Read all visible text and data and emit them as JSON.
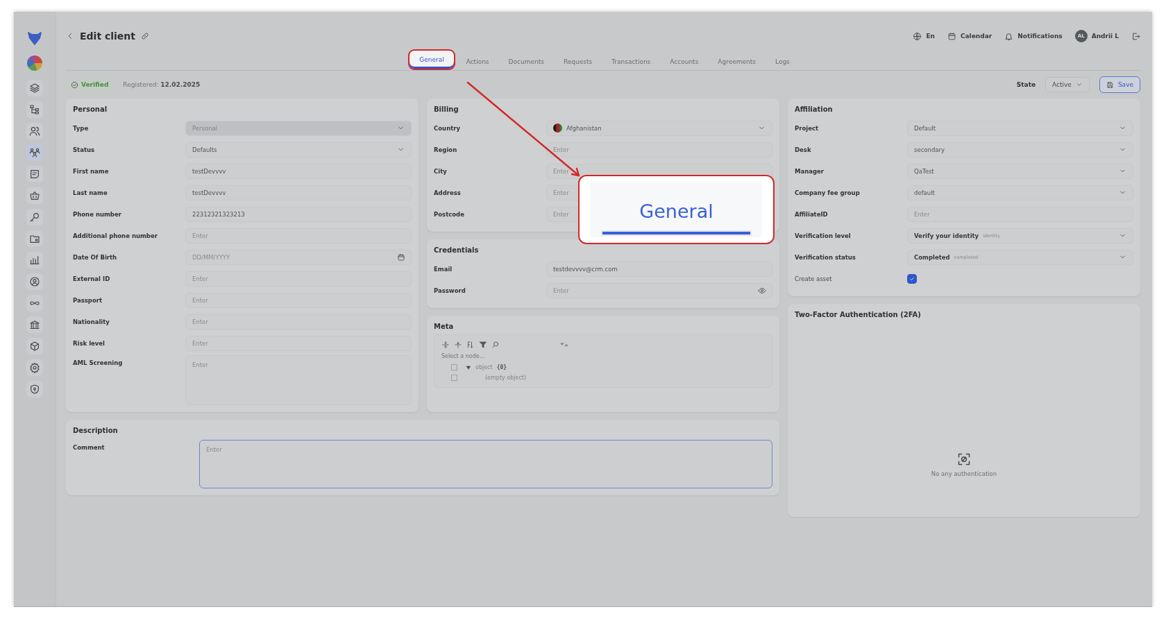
{
  "sidebar": {
    "items": [
      {
        "selected": false
      },
      {
        "selected": false
      },
      {
        "selected": false
      },
      {
        "selected": true
      },
      {
        "selected": false
      },
      {
        "selected": false
      },
      {
        "selected": false
      },
      {
        "selected": false
      },
      {
        "selected": false
      },
      {
        "selected": false
      },
      {
        "selected": false
      },
      {
        "selected": false
      },
      {
        "selected": false
      },
      {
        "selected": false
      },
      {
        "selected": false
      }
    ]
  },
  "header": {
    "title": "Edit client",
    "language": "En",
    "calendar": "Calendar",
    "notifications": "Notifications",
    "user": {
      "initials": "AL",
      "name": "Andrii L"
    }
  },
  "tabs": [
    {
      "label": "General",
      "selected": true,
      "circled": true
    },
    {
      "label": "Actions",
      "selected": false,
      "circled": false
    },
    {
      "label": "Documents",
      "selected": false,
      "circled": false
    },
    {
      "label": "Requests",
      "selected": false,
      "circled": false
    },
    {
      "label": "Transactions",
      "selected": false,
      "circled": false
    },
    {
      "label": "Accounts",
      "selected": false,
      "circled": false
    },
    {
      "label": "Agreements",
      "selected": false,
      "circled": false
    },
    {
      "label": "Logs",
      "selected": false,
      "circled": false
    }
  ],
  "status_row": {
    "badge": "Verified",
    "registered_label": "Registered:",
    "registered_date": "12.02.2025",
    "state_label": "State",
    "state_value": "Active",
    "save": "Save"
  },
  "personal": {
    "title": "Personal",
    "fields": [
      {
        "label": "Type",
        "kind": "select",
        "value": "Personal",
        "disabled": true
      },
      {
        "label": "Status",
        "kind": "select",
        "value": "Defaults",
        "disabled": false
      },
      {
        "label": "First name",
        "kind": "input",
        "value": "testDevvvv"
      },
      {
        "label": "Last name",
        "kind": "input",
        "value": "testDevvvv"
      },
      {
        "label": "Phone number",
        "kind": "input",
        "value": "22312321323213"
      },
      {
        "label": "Additional phone number",
        "kind": "input",
        "placeholder": "Enter"
      },
      {
        "label": "Date Of Birth",
        "kind": "date",
        "placeholder": "DD/MM/YYYY"
      },
      {
        "label": "External ID",
        "kind": "input",
        "placeholder": "Enter"
      },
      {
        "label": "Passport",
        "kind": "input",
        "placeholder": "Enter"
      },
      {
        "label": "Nationality",
        "kind": "input",
        "placeholder": "Enter"
      },
      {
        "label": "Risk level",
        "kind": "input",
        "placeholder": "Enter"
      },
      {
        "label": "AML Screening",
        "kind": "textarea",
        "placeholder": "Enter"
      }
    ]
  },
  "billing": {
    "title": "Billing",
    "fields": [
      {
        "label": "Country",
        "kind": "country",
        "value": "Afghanistan"
      },
      {
        "label": "Region",
        "kind": "input",
        "placeholder": "Enter"
      },
      {
        "label": "City",
        "kind": "input",
        "placeholder": "Enter"
      },
      {
        "label": "Address",
        "kind": "input",
        "placeholder": "Enter"
      },
      {
        "label": "Postcode",
        "kind": "input",
        "placeholder": "Enter"
      }
    ]
  },
  "credentials": {
    "title": "Credentials",
    "fields": [
      {
        "label": "Email",
        "kind": "input",
        "value": "testdevvvv@crm.com"
      },
      {
        "label": "Password",
        "kind": "password",
        "placeholder": "Enter"
      }
    ]
  },
  "meta": {
    "title": "Meta",
    "hint": "Select a node...",
    "tree": [
      {
        "key": "object",
        "count": "{0}",
        "expanded": true,
        "checked": false,
        "children": [
          {
            "key": "(empty object)",
            "checked": false
          }
        ]
      }
    ]
  },
  "affiliation": {
    "title": "Affiliation",
    "fields": [
      {
        "label": "Project",
        "kind": "select",
        "value": "Default"
      },
      {
        "label": "Desk",
        "kind": "select",
        "value": "secondary"
      },
      {
        "label": "Manager",
        "kind": "select",
        "value": "QaTest"
      },
      {
        "label": "Company fee group",
        "kind": "select",
        "value": "default"
      },
      {
        "label": "AffiliateID",
        "kind": "input",
        "placeholder": "Enter"
      },
      {
        "label": "Verification level",
        "kind": "select",
        "value": "Verify your identity",
        "hint": "identity"
      },
      {
        "label": "Verification status",
        "kind": "select",
        "value": "Completed",
        "hint": "completed"
      },
      {
        "label": "Create asset",
        "kind": "checkbox",
        "checked": true
      }
    ]
  },
  "two_factor": {
    "title": "Two-Factor Authentication (2FA)",
    "empty_text": "No any authentication"
  },
  "description": {
    "title": "Description",
    "fields": [
      {
        "label": "Comment",
        "kind": "textarea",
        "placeholder": "Enter",
        "focused": true
      }
    ]
  },
  "callout": {
    "text": "General"
  }
}
